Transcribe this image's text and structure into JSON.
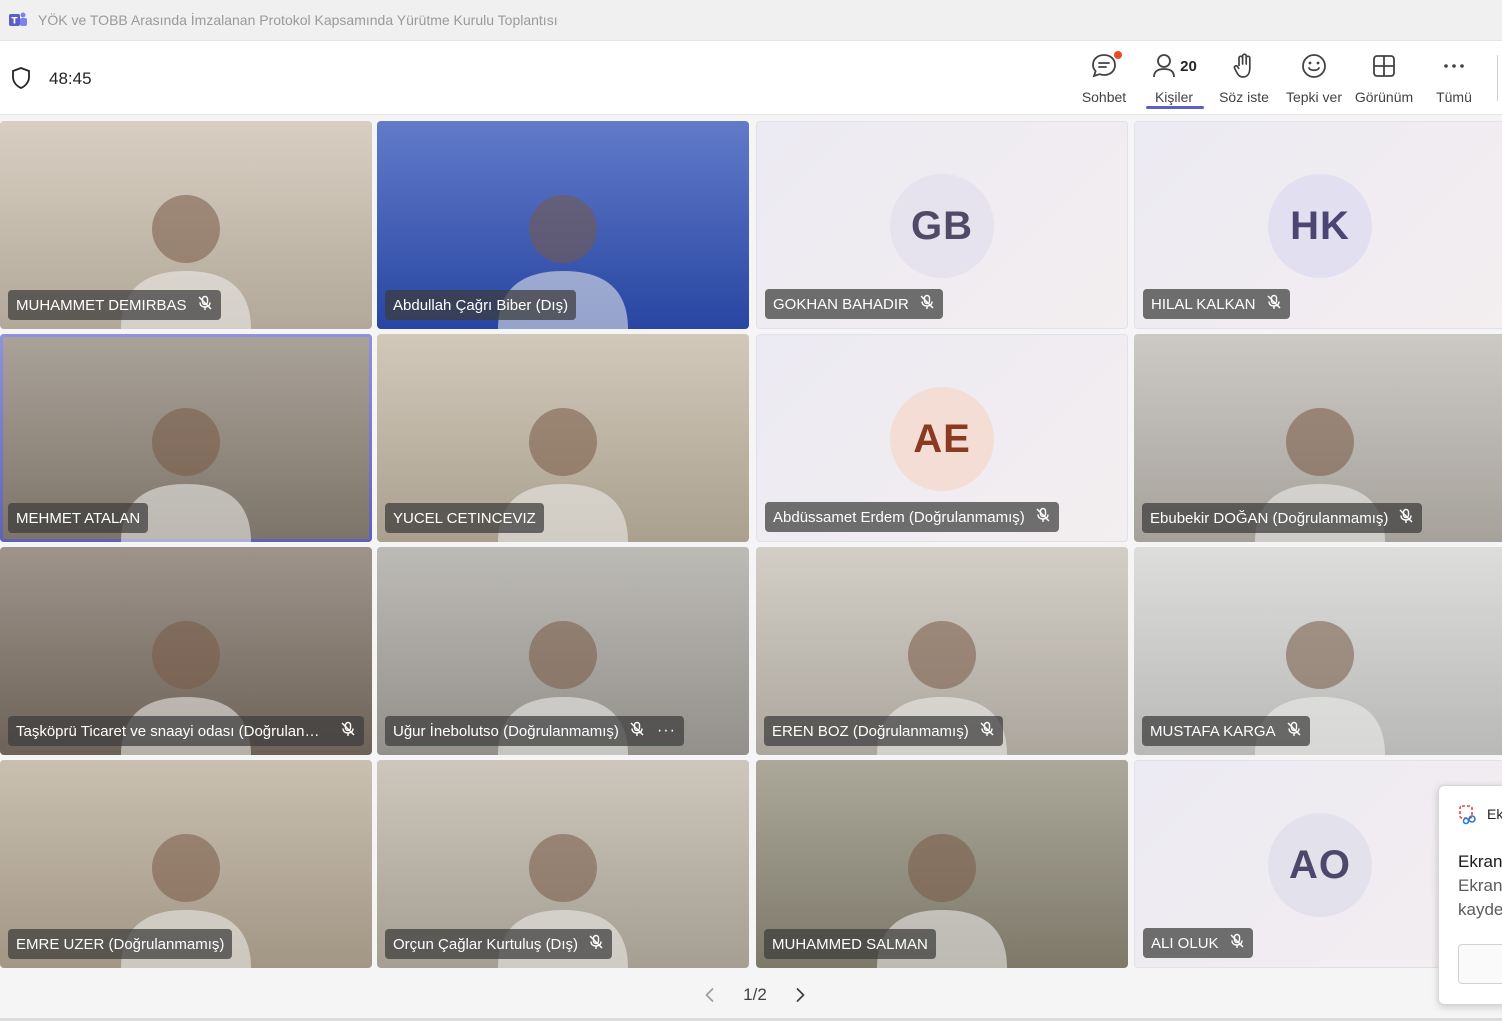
{
  "window": {
    "title": "YÖK ve TOBB Arasında İmzalanan Protokol Kapsamında Yürütme Kurulu Toplantısı"
  },
  "toolbar": {
    "timer": "48:45",
    "people_count": "20",
    "buttons": [
      {
        "id": "chat",
        "label": "Sohbet",
        "icon": "chat-icon"
      },
      {
        "id": "people",
        "label": "Kişiler",
        "icon": "people-icon"
      },
      {
        "id": "raise",
        "label": "Söz iste",
        "icon": "raise-hand-icon"
      },
      {
        "id": "react",
        "label": "Tepki ver",
        "icon": "smiley-icon"
      },
      {
        "id": "view",
        "label": "Görünüm",
        "icon": "grid-view-icon"
      },
      {
        "id": "more",
        "label": "Tümü",
        "icon": "more-icon"
      }
    ]
  },
  "participants": [
    {
      "name": "MUHAMMET DEMIRBAS",
      "muted": true,
      "video": true,
      "bg": "#cbbfae"
    },
    {
      "name": "Abdullah Çağrı Biber (Dış)",
      "muted": false,
      "video": true,
      "bg": "#2d4fb8"
    },
    {
      "name": "GOKHAN BAHADIR",
      "muted": true,
      "video": false,
      "initials": "GB",
      "avatar_bg": "#e6e2ee",
      "avatar_fg": "#4f4a66"
    },
    {
      "name": "HILAL KALKAN",
      "muted": true,
      "video": false,
      "initials": "HK",
      "avatar_bg": "#e2e0f0",
      "avatar_fg": "#4a4572"
    },
    {
      "name": "MEHMET ATALAN",
      "muted": false,
      "video": true,
      "bg": "#8e8477",
      "selected": true
    },
    {
      "name": "YUCEL CETINCEVIZ",
      "muted": false,
      "video": true,
      "bg": "#c2b6a3"
    },
    {
      "name": "Abdüssamet Erdem (Doğrulanmamış)",
      "muted": true,
      "video": false,
      "initials": "AE",
      "avatar_bg": "#f3ddd5",
      "avatar_fg": "#8b3a22"
    },
    {
      "name": "Ebubekir DOĞAN (Doğrulanmamış)",
      "muted": true,
      "video": true,
      "bg": "#bcb7b0"
    },
    {
      "name": "Taşköprü Ticaret ve snaayi odası (Doğrulanmamış)",
      "muted": true,
      "video": true,
      "bg": "#7d7064"
    },
    {
      "name": "Uğur İnebolutso (Doğrulanmamış)",
      "muted": true,
      "video": true,
      "bg": "#a7a49e",
      "more": true
    },
    {
      "name": "EREN BOZ (Doğrulanmamış)",
      "muted": true,
      "video": true,
      "bg": "#c4beb3"
    },
    {
      "name": "MUSTAFA KARGA",
      "muted": true,
      "video": true,
      "bg": "#d2d2d0"
    },
    {
      "name": "EMRE UZER (Doğrulanmamış)",
      "muted": false,
      "video": true,
      "bg": "#b8ab96"
    },
    {
      "name": "Orçun Çağlar Kurtuluş (Dış)",
      "muted": true,
      "video": true,
      "bg": "#bcb4a6"
    },
    {
      "name": "MUHAMMED SALMAN",
      "muted": false,
      "video": true,
      "bg": "#8f8a78"
    },
    {
      "name": "ALI OLUK",
      "muted": true,
      "video": false,
      "initials": "AO",
      "avatar_bg": "#e3e1ec",
      "avatar_fg": "#4d4869"
    }
  ],
  "pager": {
    "text": "1/2"
  },
  "toast": {
    "app": "Ek",
    "heading": "Ekran",
    "line1": "Ekran",
    "line2": "kayde"
  },
  "colors": {
    "accent": "#5b5fc7",
    "notification": "#e9492b"
  }
}
